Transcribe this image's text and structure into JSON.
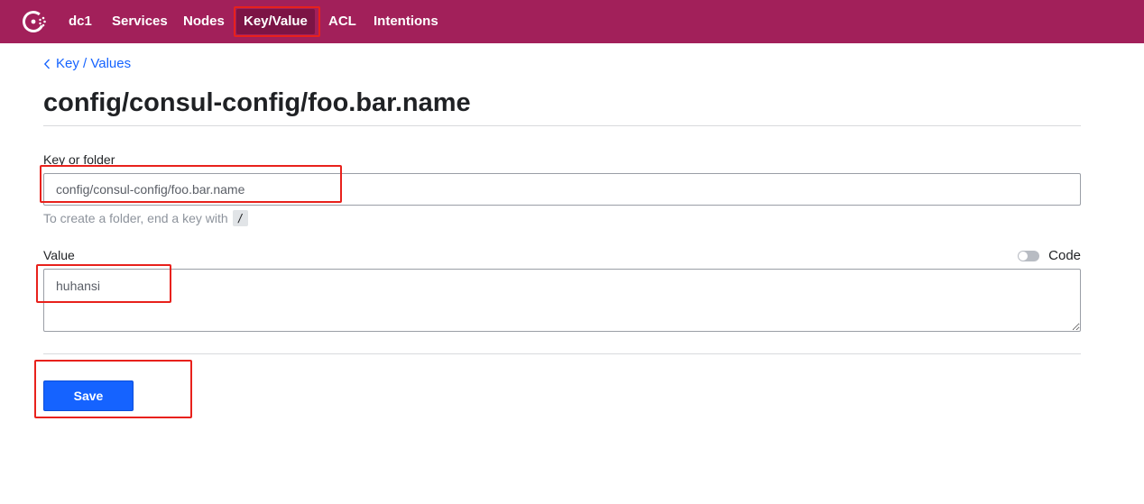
{
  "topbar": {
    "logo_icon": "consul-logo-icon",
    "datacenter": "dc1",
    "items": [
      "Services",
      "Nodes",
      "Key/Value",
      "ACL",
      "Intentions"
    ],
    "active": "Key/Value",
    "background": "#a2205a"
  },
  "breadcrumb": {
    "label": "Key / Values",
    "icon": "chevron-left-icon"
  },
  "page": {
    "title": "config/consul-config/foo.bar.name"
  },
  "form": {
    "key_label": "Key or folder",
    "key_value": "config/consul-config/foo.bar.name",
    "key_help": "To create a folder, end a key with",
    "key_help_code": "/",
    "value_label": "Value",
    "value_text": "huhansi",
    "code_toggle_label": "Code",
    "code_toggle_on": false,
    "save_label": "Save"
  },
  "colors": {
    "accent": "#1563ff",
    "annotation": "#e8211c"
  }
}
